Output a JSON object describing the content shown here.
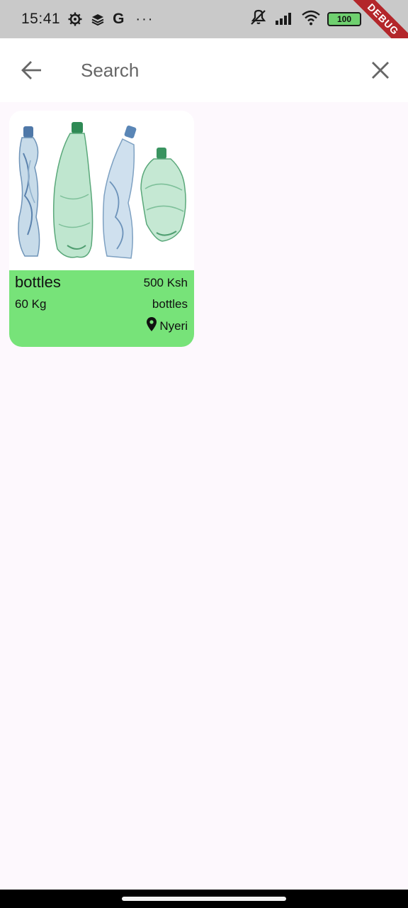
{
  "status_bar": {
    "time": "15:41",
    "g_label": "G",
    "more": "···",
    "battery": "100"
  },
  "debug_banner": "DEBUG",
  "search": {
    "placeholder": "Search",
    "value": ""
  },
  "results": [
    {
      "title": "bottles",
      "price": "500 Ksh",
      "weight": "60 Kg",
      "category": "bottles",
      "location": "Nyeri",
      "image": "plastic-bottles-image"
    }
  ],
  "colors": {
    "card_info_bg": "#77e379",
    "page_bg": "#fdf8fd",
    "status_bar_bg": "#c9c9c9"
  }
}
